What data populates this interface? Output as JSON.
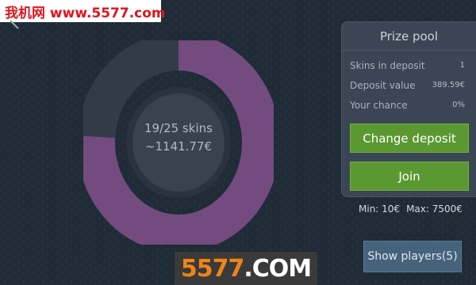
{
  "watermark_top": {
    "text": "我机网 www.5577.com"
  },
  "watermark_bottom": {
    "number": "5577",
    "suffix": ".COM"
  },
  "pot": {
    "skins_text": "19/25 skins",
    "value_text": "~1141.77€",
    "fill_fraction": 0.76,
    "filled_color": "#734b7e",
    "empty_color": "#323c48"
  },
  "prize_pool": {
    "title": "Prize pool",
    "rows": [
      {
        "label": "Skins in deposit",
        "value": "1"
      },
      {
        "label": "Deposit value",
        "value": "389.59€"
      },
      {
        "label": "Your chance",
        "value": "0%"
      }
    ],
    "change_deposit_label": "Change deposit",
    "join_label": "Join"
  },
  "limits": {
    "min": "Min: 10€",
    "max": "Max: 7500€"
  },
  "show_players_label": "Show players(5)",
  "colors": {
    "accent_green": "#5b9832",
    "panel": "#3a4654",
    "background": "#1f2b36"
  }
}
